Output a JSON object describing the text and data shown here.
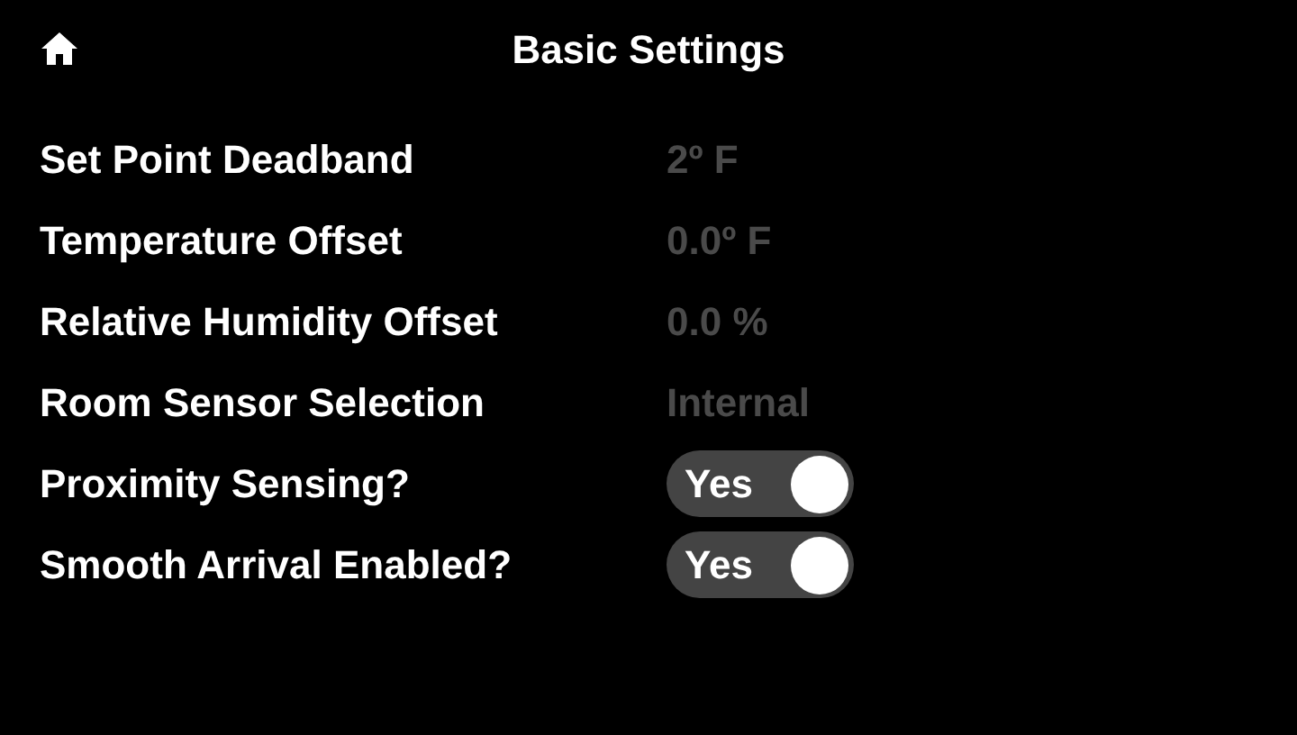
{
  "header": {
    "title": "Basic Settings"
  },
  "settings": [
    {
      "label": "Set Point Deadband",
      "kind": "value",
      "value": "2º F"
    },
    {
      "label": "Temperature Offset",
      "kind": "value",
      "value": "0.0º F"
    },
    {
      "label": "Relative Humidity Offset",
      "kind": "value",
      "value": "0.0 %"
    },
    {
      "label": "Room Sensor Selection",
      "kind": "value",
      "value": "Internal"
    },
    {
      "label": "Proximity Sensing?",
      "kind": "toggle",
      "value": "Yes",
      "on": true
    },
    {
      "label": "Smooth Arrival Enabled?",
      "kind": "toggle",
      "value": "Yes",
      "on": true
    }
  ]
}
